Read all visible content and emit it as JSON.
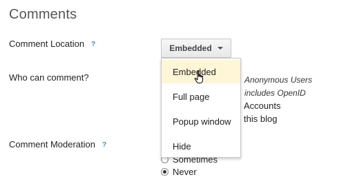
{
  "section": {
    "title": "Comments"
  },
  "comment_location": {
    "label": "Comment Location",
    "help": "?",
    "selected": "Embedded",
    "options": [
      "Embedded",
      "Full page",
      "Popup window",
      "Hide"
    ]
  },
  "who_can_comment": {
    "label": "Who can comment?",
    "partial_options": [
      "Anonymous Users",
      "includes OpenID",
      "Accounts",
      "this blog"
    ]
  },
  "comment_moderation": {
    "label": "Comment Moderation",
    "help": "?",
    "options": [
      "Sometimes",
      "Never"
    ],
    "selected": "Never"
  }
}
